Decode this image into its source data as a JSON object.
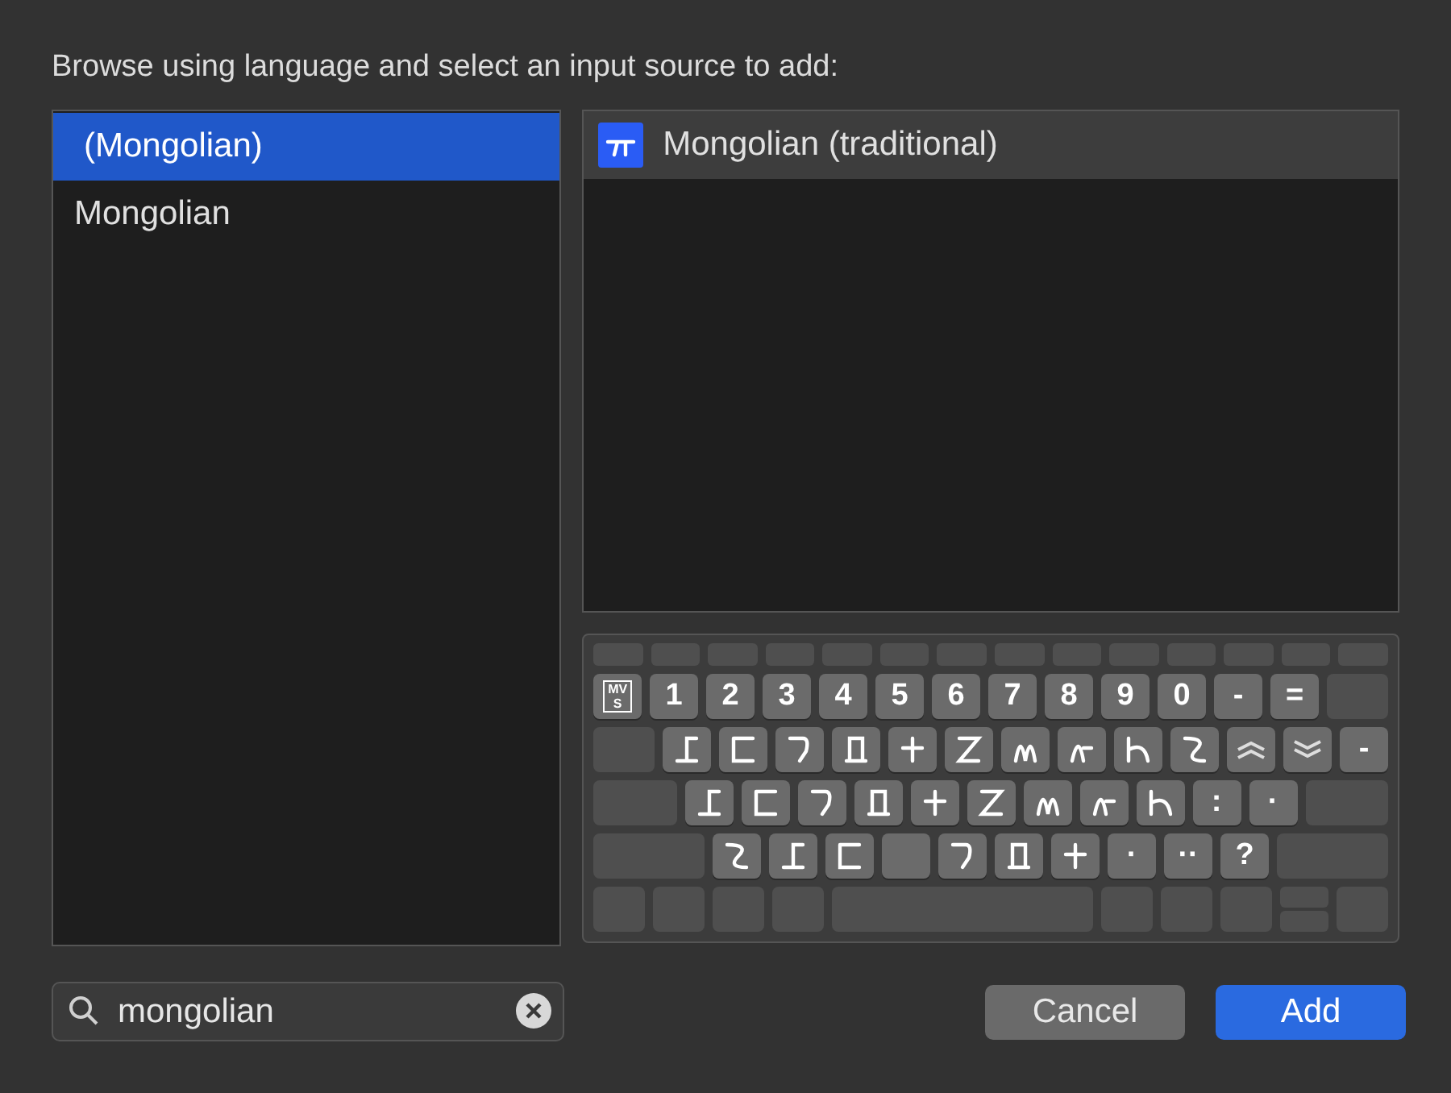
{
  "heading": "Browse using language and select an input source to add:",
  "languages": [
    {
      "label": "(Mongolian)",
      "selected": true
    },
    {
      "label": "Mongolian",
      "selected": false
    }
  ],
  "sources": [
    {
      "label": "Mongolian (traditional)",
      "selected": true
    }
  ],
  "keyboard": {
    "function_row": [
      {
        "kind": "fn"
      },
      {
        "kind": "fn"
      },
      {
        "kind": "fn"
      },
      {
        "kind": "fn"
      },
      {
        "kind": "fn"
      },
      {
        "kind": "fn"
      },
      {
        "kind": "fn"
      },
      {
        "kind": "fn"
      },
      {
        "kind": "fn"
      },
      {
        "kind": "fn"
      },
      {
        "kind": "fn"
      },
      {
        "kind": "fn"
      },
      {
        "kind": "fn"
      },
      {
        "kind": "fn"
      }
    ],
    "rows": [
      {
        "keys": [
          {
            "kind": "boxed",
            "label": "MVS"
          },
          {
            "kind": "key",
            "label": "1"
          },
          {
            "kind": "key",
            "label": "2"
          },
          {
            "kind": "key",
            "label": "3"
          },
          {
            "kind": "key",
            "label": "4"
          },
          {
            "kind": "key",
            "label": "5"
          },
          {
            "kind": "key",
            "label": "6"
          },
          {
            "kind": "key",
            "label": "7"
          },
          {
            "kind": "key",
            "label": "8"
          },
          {
            "kind": "key",
            "label": "9"
          },
          {
            "kind": "key",
            "label": "0"
          },
          {
            "kind": "key",
            "label": "-"
          },
          {
            "kind": "key",
            "label": "="
          },
          {
            "kind": "blank"
          }
        ]
      },
      {
        "keys": [
          {
            "kind": "blank"
          },
          {
            "kind": "glyph"
          },
          {
            "kind": "glyph"
          },
          {
            "kind": "glyph"
          },
          {
            "kind": "glyph"
          },
          {
            "kind": "glyph"
          },
          {
            "kind": "glyph"
          },
          {
            "kind": "glyph"
          },
          {
            "kind": "glyph"
          },
          {
            "kind": "glyph"
          },
          {
            "kind": "glyph"
          },
          {
            "kind": "chevron-up"
          },
          {
            "kind": "chevron-down"
          },
          {
            "kind": "key",
            "label": "-"
          }
        ]
      },
      {
        "keys": [
          {
            "kind": "blank"
          },
          {
            "kind": "glyph"
          },
          {
            "kind": "glyph"
          },
          {
            "kind": "glyph"
          },
          {
            "kind": "glyph"
          },
          {
            "kind": "glyph"
          },
          {
            "kind": "glyph"
          },
          {
            "kind": "glyph"
          },
          {
            "kind": "glyph"
          },
          {
            "kind": "glyph"
          },
          {
            "kind": "key",
            "label": ":"
          },
          {
            "kind": "key",
            "label": "·"
          },
          {
            "kind": "blank"
          }
        ]
      },
      {
        "keys": [
          {
            "kind": "blank"
          },
          {
            "kind": "glyph"
          },
          {
            "kind": "glyph"
          },
          {
            "kind": "glyph"
          },
          {
            "kind": "empty"
          },
          {
            "kind": "glyph"
          },
          {
            "kind": "glyph"
          },
          {
            "kind": "glyph"
          },
          {
            "kind": "key",
            "label": "·"
          },
          {
            "kind": "key",
            "label": "··"
          },
          {
            "kind": "key",
            "label": "?"
          },
          {
            "kind": "blank"
          }
        ]
      },
      {
        "keys": [
          {
            "kind": "modifier"
          },
          {
            "kind": "modifier"
          },
          {
            "kind": "modifier"
          },
          {
            "kind": "modifier"
          },
          {
            "kind": "space"
          },
          {
            "kind": "modifier"
          },
          {
            "kind": "modifier"
          },
          {
            "kind": "modifier"
          },
          {
            "kind": "split"
          },
          {
            "kind": "modifier"
          }
        ]
      }
    ]
  },
  "search": {
    "value": "mongolian"
  },
  "buttons": [
    {
      "label": "Cancel",
      "kind": "secondary"
    },
    {
      "label": "Add",
      "kind": "primary"
    }
  ]
}
